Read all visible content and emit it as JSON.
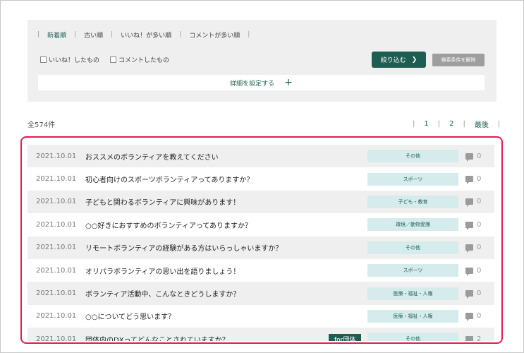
{
  "sort": {
    "items": [
      {
        "label": "新着順"
      },
      {
        "label": "古い順"
      },
      {
        "label": "いいね！が多い順"
      },
      {
        "label": "コメントが多い順"
      }
    ]
  },
  "filters": {
    "liked_label": "いいね！したもの",
    "commented_label": "コメントしたもの",
    "narrow_label": "絞り込む",
    "clear_label": "検索条件を解除",
    "detail_label": "詳細を設定する"
  },
  "results": {
    "total": "全574件",
    "pages": [
      "1",
      "2",
      "最後"
    ]
  },
  "colors": {
    "accent": "#1e5e52",
    "category_bg": "#d6ecec",
    "highlight": "#e8194e"
  },
  "posts": [
    {
      "date": "2021.10.01",
      "title": "おススメのボランティアを教えてください",
      "category": "その他",
      "comments": "0"
    },
    {
      "date": "2021.10.01",
      "title": "初心者向けのスポーツボランティアってありますか？",
      "category": "スポーツ",
      "comments": "0"
    },
    {
      "date": "2021.10.01",
      "title": "子どもと関わるボランティアに興味があります！",
      "category": "子ども・教育",
      "comments": "0"
    },
    {
      "date": "2021.10.01",
      "title": "○○好きにおすすめのボランティアってありますか？",
      "category": "環境／動物愛護",
      "comments": "0"
    },
    {
      "date": "2021.10.01",
      "title": "リモートボランティアの経験がある方はいらっしゃいますか？",
      "category": "その他",
      "comments": "0"
    },
    {
      "date": "2021.10.01",
      "title": "オリパラボランティアの思い出を語りましょう！",
      "category": "スポーツ",
      "comments": "0"
    },
    {
      "date": "2021.10.01",
      "title": "ボランティア活動中、こんなときどうしますか？",
      "category": "医療・福祉・人権",
      "comments": "0"
    },
    {
      "date": "2021.10.01",
      "title": "○○についてどう思います？",
      "category": "医療・福祉・人権",
      "comments": "0"
    },
    {
      "date": "2021.10.01",
      "title": "団体内のDXってどんなことされていますか？",
      "category": "その他",
      "comments": "2",
      "badge": "for団体"
    }
  ]
}
